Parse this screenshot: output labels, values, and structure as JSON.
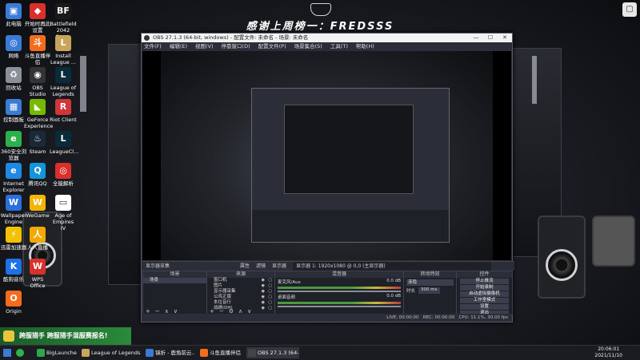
{
  "banner": {
    "text": "感谢上周榜一：FREDSSS"
  },
  "desktop_icons": [
    {
      "label": "此电脑",
      "color": "#3a7bd5",
      "glyph": "▣"
    },
    {
      "label": "网络",
      "color": "#3a7bd5",
      "glyph": "◎"
    },
    {
      "label": "回收站",
      "color": "#8a8f99",
      "glyph": "♻"
    },
    {
      "label": "控制面板",
      "color": "#3a7bd5",
      "glyph": "▦"
    },
    {
      "label": "360安全浏览器",
      "color": "#2bb24c",
      "glyph": "e"
    },
    {
      "label": "Internet Explorer",
      "color": "#1e88e5",
      "glyph": "e"
    },
    {
      "label": "Wallpaper Engine",
      "color": "#2a6fdb",
      "glyph": "W"
    },
    {
      "label": "迅雷加速器",
      "color": "#f2c200",
      "glyph": "⚡"
    },
    {
      "label": "酷狗音乐",
      "color": "#1d72e8",
      "glyph": "K"
    },
    {
      "label": "Origin",
      "color": "#f56c1d",
      "glyph": "O"
    },
    {
      "label": "开始时再此设置",
      "color": "#d9302c",
      "glyph": "◆"
    },
    {
      "label": "斗鱼直播伴侣",
      "color": "#f26d1d",
      "glyph": "斗"
    },
    {
      "label": "OBS Studio",
      "color": "#333333",
      "glyph": "◉"
    },
    {
      "label": "GeForce Experience",
      "color": "#76b900",
      "glyph": "◣"
    },
    {
      "label": "Steam",
      "color": "#1b2838",
      "glyph": "♨"
    },
    {
      "label": "腾讯QQ",
      "color": "#1296db",
      "glyph": "Q"
    },
    {
      "label": "WeGame",
      "color": "#f5b400",
      "glyph": "W"
    },
    {
      "label": "人人直播",
      "color": "#f2a900",
      "glyph": "人"
    },
    {
      "label": "WPS Office",
      "color": "#d9302c",
      "glyph": "W"
    },
    {
      "label": "Battlefield 2042 Ope...",
      "color": "#1a1a1a",
      "glyph": "BF"
    },
    {
      "label": "Install League ...",
      "color": "#c8a55a",
      "glyph": "L"
    },
    {
      "label": "League of Legends",
      "color": "#0a2b3a",
      "glyph": "L"
    },
    {
      "label": "Riot Client",
      "color": "#d13639",
      "glyph": "R"
    },
    {
      "label": "LeagueCl...",
      "color": "#0a2b3a",
      "glyph": "L"
    },
    {
      "label": "全能解析",
      "color": "#d9302c",
      "glyph": "◎"
    },
    {
      "label": "Age of Empires IV",
      "color": "#ffffff",
      "glyph": "▭"
    }
  ],
  "obs": {
    "title": "OBS 27.1.3 (64-bit, windows) - 配置文件: 未命名 - 场景: 未命名",
    "menu": [
      "文件(F)",
      "编辑(E)",
      "视图(V)",
      "停靠窗口(D)",
      "配置文件(P)",
      "场景集合(S)",
      "工具(T)",
      "帮助(H)"
    ],
    "scenebar": {
      "source": "显示器采集",
      "props": "属性",
      "filters": "滤镜",
      "display_label": "显示器",
      "display_value": "显示器 1: 1920x1080 @ 0,0 (主显示器)"
    },
    "docks": {
      "scenes": {
        "title": "场景",
        "items": [
          "场景"
        ]
      },
      "sources": {
        "title": "来源",
        "items": [
          "窗口机",
          "图片",
          "显示器采集",
          "公鸡正版",
          "本位音行",
          "战绩(DH)"
        ]
      },
      "mixer": {
        "title": "混音器",
        "tracks": [
          {
            "name": "麦克风/Aux",
            "db": "0.0 dB"
          },
          {
            "name": "桌面音频",
            "db": "0.0 dB"
          }
        ]
      },
      "transitions": {
        "title": "转场特效",
        "type": "渐隐",
        "duration_label": "时长",
        "duration": "300 ms"
      },
      "controls": {
        "title": "控件",
        "buttons": [
          "停止推流",
          "开始录制",
          "启动虚拟摄像机",
          "工作室模式",
          "设置",
          "退出"
        ]
      }
    },
    "status": {
      "live": "LIVE: 00:00:00",
      "rec": "REC: 00:00:00",
      "cpu": "CPU: 11.1%, 30.00 fps"
    }
  },
  "promo": {
    "text": "跨服猎手 跨服猎手混服赛报名!"
  },
  "taskbar": {
    "items": [
      {
        "label": "BigLauncher",
        "color": "#2aa84a"
      },
      {
        "label": "League of Legends",
        "color": "#c8a55a"
      },
      {
        "label": "镜折 - 鹿角前云...",
        "color": "#3a7bd5"
      },
      {
        "label": "斗鱼直播伴侣",
        "color": "#f26d1d"
      },
      {
        "label": "OBS 27.1.3 (64-bit...",
        "color": "#444444"
      }
    ],
    "time": "20:06:01",
    "date": "2021/11/10"
  }
}
